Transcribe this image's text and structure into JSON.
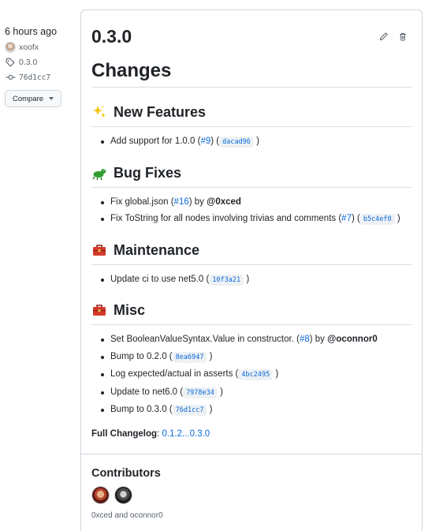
{
  "meta": {
    "time": "6 hours ago",
    "author": "xoofx",
    "tag": "0.3.0",
    "commit": "76d1cc7",
    "compare_label": "Compare"
  },
  "release": {
    "title": "0.3.0",
    "changes_heading": "Changes",
    "sections": [
      {
        "icon": "sparkles-icon",
        "title": "New Features",
        "items": [
          {
            "text": "Add support for 1.0.0 (",
            "link": "#9",
            "mid": ") (",
            "sha": "dacad96",
            "tail": ")"
          }
        ]
      },
      {
        "icon": "bug-icon",
        "title": "Bug Fixes",
        "items": [
          {
            "text": "Fix global.json (",
            "link": "#16",
            "mid": ") by ",
            "user": "@0xced"
          },
          {
            "text": "Fix ToString for all nodes involving trivias and comments (",
            "link": "#7",
            "mid": ") (",
            "sha": "b5c4ef0",
            "tail": ")"
          }
        ]
      },
      {
        "icon": "toolbox-icon",
        "title": "Maintenance",
        "items": [
          {
            "text": "Update ci to use net5.0 (",
            "sha": "10f3a21",
            "tail": ")"
          }
        ]
      },
      {
        "icon": "toolbox-icon",
        "title": "Misc",
        "items": [
          {
            "text": "Set BooleanValueSyntax.Value in constructor. (",
            "link": "#8",
            "mid": ") by ",
            "user": "@oconnor0"
          },
          {
            "text": "Bump to 0.2.0 (",
            "sha": "8ea6947",
            "tail": ")"
          },
          {
            "text": "Log expected/actual in asserts (",
            "sha": "4bc2495",
            "tail": ")"
          },
          {
            "text": "Update to net6.0 (",
            "sha": "7978e34",
            "tail": ")"
          },
          {
            "text": "Bump to 0.3.0 (",
            "sha": "76d1cc7",
            "tail": ")"
          }
        ]
      }
    ],
    "full_changelog_label": "Full Changelog",
    "full_changelog_link": "0.1.2...0.3.0"
  },
  "contributors": {
    "title": "Contributors",
    "names": "0xced and oconnor0"
  },
  "colors": {
    "link": "#0969da",
    "border": "#d0d7de",
    "text": "#1f2328",
    "muted": "#59636e"
  }
}
